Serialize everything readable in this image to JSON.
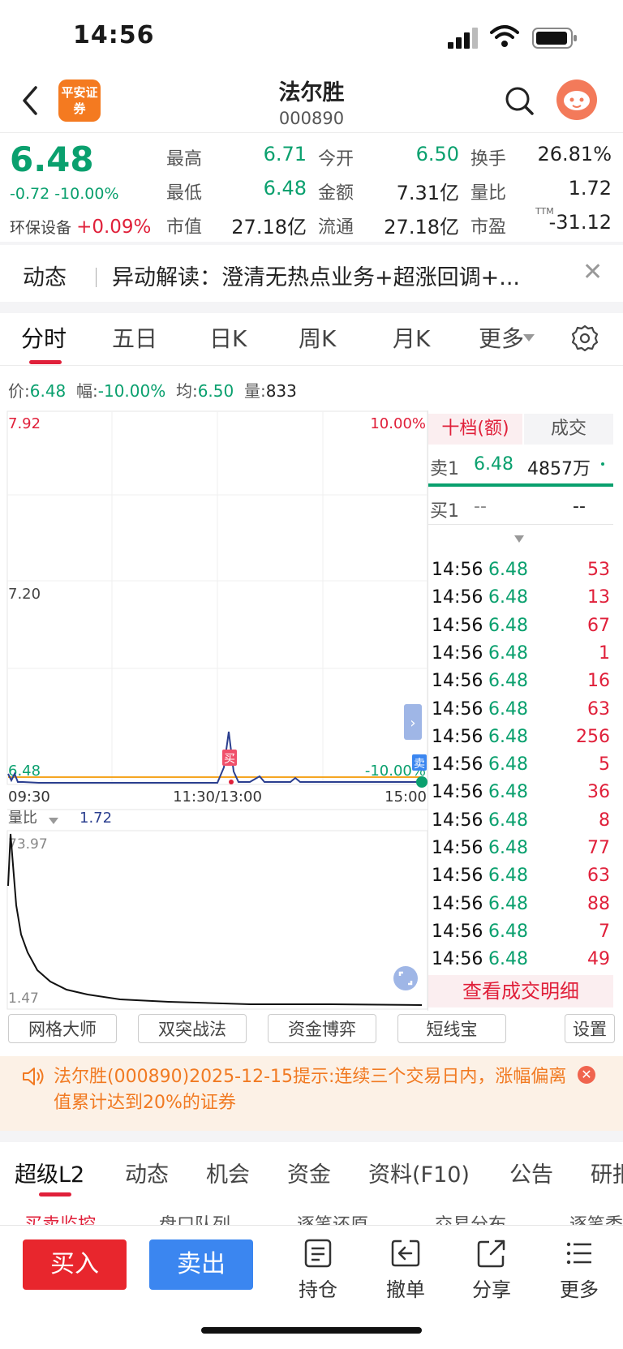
{
  "status_bar": {
    "time": "14:56"
  },
  "header": {
    "logo_text": "平安证券",
    "stock_name": "法尔胜",
    "stock_code": "000890"
  },
  "quote": {
    "price": "6.48",
    "change": "-0.72 -10.00%",
    "sector": "环保设备",
    "sector_change": "+0.09%",
    "fields": [
      {
        "label": "最高",
        "value": "6.71",
        "color": "#0aa06e"
      },
      {
        "label": "今开",
        "value": "6.50",
        "color": "#0aa06e"
      },
      {
        "label": "换手",
        "value": "26.81%",
        "color": "#222222"
      },
      {
        "label": "最低",
        "value": "6.48",
        "color": "#0aa06e"
      },
      {
        "label": "金额",
        "value": "7.31亿",
        "color": "#222222"
      },
      {
        "label": "量比",
        "value": "1.72",
        "color": "#222222"
      },
      {
        "label": "市值",
        "value": "27.18亿",
        "color": "#222222"
      },
      {
        "label": "流通",
        "value": "27.18亿",
        "color": "#222222"
      },
      {
        "label": "市盈",
        "value": "-31.12",
        "color": "#222222"
      }
    ],
    "pe_suffix": "TTM"
  },
  "news": {
    "tag": "动态",
    "text": "异动解读：澄清无热点业务+超涨回调+..."
  },
  "period_tabs": [
    "分时",
    "五日",
    "日K",
    "周K",
    "月K",
    "更多"
  ],
  "info_line": {
    "price_label": "价:",
    "price": "6.48",
    "amp_label": "幅:",
    "amp": "-10.00%",
    "avg_label": "均:",
    "avg": "6.50",
    "vol_label": "量:",
    "vol": "833"
  },
  "chart_data": {
    "type": "line",
    "price_axis": {
      "max": "7.92",
      "mid": "7.20",
      "min": "6.48",
      "pct_max": "10.00%",
      "pct_min": "-10.00%"
    },
    "time_labels": [
      "09:30",
      "11:30/13:00",
      "15:00"
    ],
    "markers": {
      "buy": "买",
      "sell": "卖"
    },
    "volume_ratio": {
      "label": "量比",
      "value": "1.72",
      "max": "73.97",
      "min": "1.47"
    }
  },
  "order_book": {
    "tab_active": "十档(额)",
    "tab_other": "成交",
    "sell1": {
      "label": "卖1",
      "price": "6.48",
      "amount": "4857万"
    },
    "buy1": {
      "label": "买1",
      "price": "--",
      "amount": "--"
    },
    "trades": [
      {
        "time": "14:56",
        "price": "6.48",
        "vol": "53"
      },
      {
        "time": "14:56",
        "price": "6.48",
        "vol": "13"
      },
      {
        "time": "14:56",
        "price": "6.48",
        "vol": "67"
      },
      {
        "time": "14:56",
        "price": "6.48",
        "vol": "1"
      },
      {
        "time": "14:56",
        "price": "6.48",
        "vol": "16"
      },
      {
        "time": "14:56",
        "price": "6.48",
        "vol": "63"
      },
      {
        "time": "14:56",
        "price": "6.48",
        "vol": "256"
      },
      {
        "time": "14:56",
        "price": "6.48",
        "vol": "5"
      },
      {
        "time": "14:56",
        "price": "6.48",
        "vol": "36"
      },
      {
        "time": "14:56",
        "price": "6.48",
        "vol": "8"
      },
      {
        "time": "14:56",
        "price": "6.48",
        "vol": "77"
      },
      {
        "time": "14:56",
        "price": "6.48",
        "vol": "63"
      },
      {
        "time": "14:56",
        "price": "6.48",
        "vol": "88"
      },
      {
        "time": "14:56",
        "price": "6.48",
        "vol": "7"
      },
      {
        "time": "14:56",
        "price": "6.48",
        "vol": "49"
      }
    ],
    "detail_button": "查看成交明细"
  },
  "strategy_buttons": [
    "网格大师",
    "双突战法",
    "资金博弈",
    "短线宝",
    "设置"
  ],
  "warning": {
    "text": "法尔胜(000890)2025-12-15提示:连续三个交易日内，涨幅偏离值累计达到20%的证券"
  },
  "bottom_tabs": [
    "超级L2",
    "动态",
    "机会",
    "资金",
    "资料(F10)",
    "公告",
    "研报"
  ],
  "sub_tabs": [
    "买卖监控",
    "盘口队列",
    "逐笔还原",
    "交易分布",
    "逐笔委托"
  ],
  "actions": {
    "buy": "买入",
    "sell": "卖出",
    "hold": "持仓",
    "cancel": "撤单",
    "share": "分享",
    "more": "更多"
  }
}
